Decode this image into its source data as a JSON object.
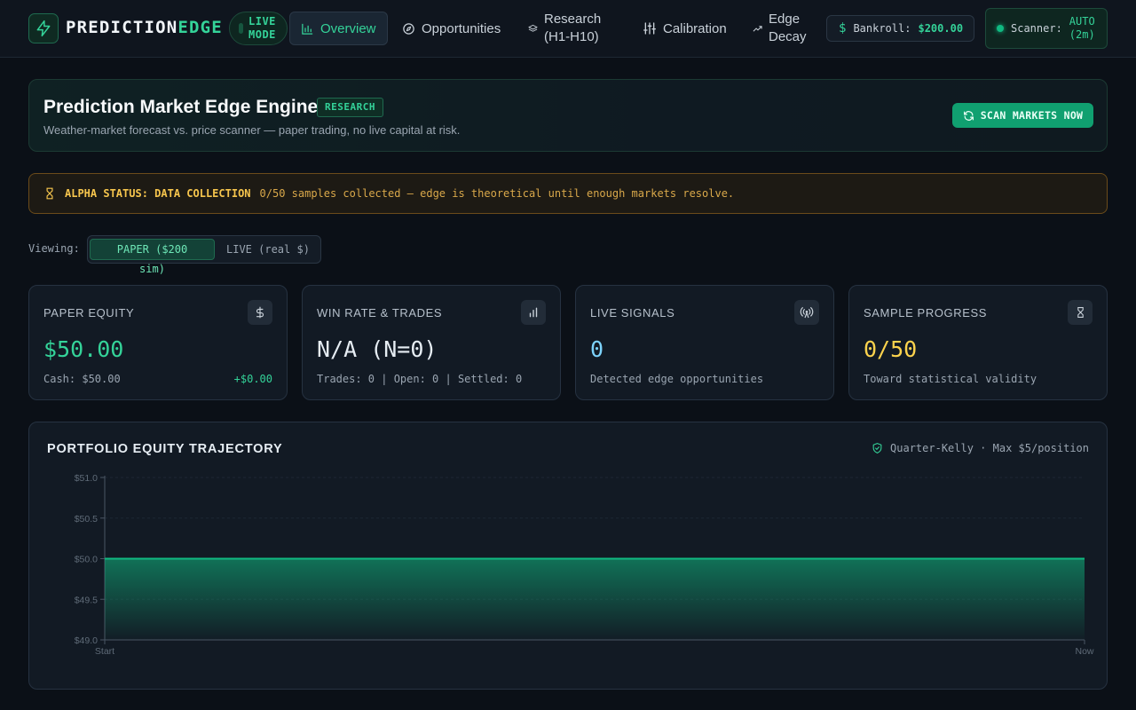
{
  "brand": {
    "part1": "PREDICTION",
    "part2": "EDGE",
    "icon": "lightning-icon"
  },
  "mode": {
    "line1": "LIVE",
    "line2": "MODE"
  },
  "nav": {
    "overview": "Overview",
    "opportunities": "Opportunities",
    "research_line1": "Research",
    "research_line2": "(H1-H10)",
    "calibration": "Calibration",
    "edge_decay_line1": "Edge",
    "edge_decay_line2": "Decay"
  },
  "bankroll": {
    "label": "Bankroll:",
    "value": "$200.00"
  },
  "scanner": {
    "label": "Scanner:",
    "status_line1": "AUTO",
    "status_line2": "(2m)"
  },
  "hero": {
    "title": "Prediction Market Edge Engine",
    "badge": "RESEARCH",
    "subtitle": "Weather-market forecast vs. price scanner — paper trading, no live capital at risk.",
    "scan_button": "SCAN MARKETS NOW"
  },
  "alpha": {
    "label": "ALPHA STATUS: DATA COLLECTION",
    "message": "0/50 samples collected — edge is theoretical until enough markets resolve."
  },
  "viewing": {
    "label": "Viewing:",
    "paper": "PAPER ($200 sim)",
    "live": "LIVE (real $)"
  },
  "cards": [
    {
      "title": "PAPER EQUITY",
      "value": "$50.00",
      "sub": "Cash: $50.00",
      "delta": "+$0.00",
      "color": "#34d399",
      "icon": "dollar-icon"
    },
    {
      "title": "WIN RATE & TRADES",
      "value": "N/A (N=0)",
      "sub": "Trades: 0 | Open: 0 | Settled: 0",
      "color": "#e6edf3",
      "icon": "bar-chart-icon"
    },
    {
      "title": "LIVE SIGNALS",
      "value": "0",
      "sub": "Detected edge opportunities",
      "color": "#7dd3fc",
      "icon": "antenna-icon"
    },
    {
      "title": "SAMPLE PROGRESS",
      "value": "0/50",
      "sub": "Toward statistical validity",
      "color": "#fcd34d",
      "icon": "hourglass-icon"
    }
  ],
  "chart_panel": {
    "title": "PORTFOLIO EQUITY TRAJECTORY",
    "note": "Quarter-Kelly · Max $5/position"
  },
  "chart_data": {
    "type": "area",
    "x": [
      "Start",
      "Now"
    ],
    "series": [
      {
        "values": [
          50.0,
          50.0
        ]
      }
    ],
    "y_ticks": [
      "$51.0",
      "$50.5",
      "$50.0",
      "$49.5",
      "$49.0"
    ],
    "y_tick_values": [
      51.0,
      50.5,
      50.0,
      49.5,
      49.0
    ],
    "ylim": [
      49.0,
      51.0
    ],
    "grid": true,
    "color": "#10b981"
  }
}
